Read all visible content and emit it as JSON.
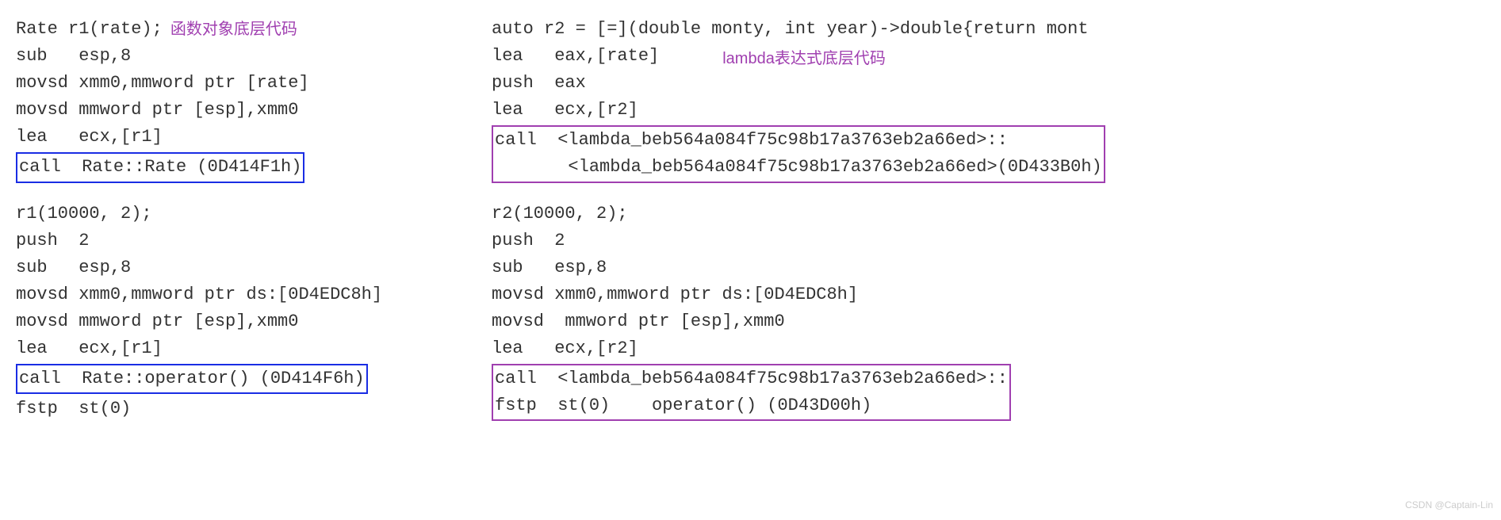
{
  "left": {
    "annotation": "函数对象底层代码",
    "decl": "Rate r1(rate);",
    "asm1": [
      "sub   esp,8",
      "movsd xmm0,mmword ptr [rate]",
      "movsd mmword ptr [esp],xmm0",
      "lea   ecx,[r1]"
    ],
    "box1": "call  Rate::Rate (0D414F1h)",
    "invoke": "r1(10000, 2);",
    "asm2": [
      "push  2",
      "sub   esp,8",
      "movsd xmm0,mmword ptr ds:[0D4EDC8h]",
      "movsd mmword ptr [esp],xmm0",
      "lea   ecx,[r1]"
    ],
    "box2": "call  Rate::operator() (0D414F6h)",
    "tail": "fstp  st(0)"
  },
  "right": {
    "annotation": "lambda表达式底层代码",
    "decl": "auto r2 = [=](double monty, int year)->double{return mont",
    "asm1": [
      "lea   eax,[rate]",
      "push  eax",
      "lea   ecx,[r2]"
    ],
    "box1a": "call  <lambda_beb564a084f75c98b17a3763eb2a66ed>::",
    "box1b": "       <lambda_beb564a084f75c98b17a3763eb2a66ed>(0D433B0h)",
    "invoke": "r2(10000, 2);",
    "asm2": [
      "push  2",
      "sub   esp,8",
      "movsd xmm0,mmword ptr ds:[0D4EDC8h]",
      "movsd  mmword ptr [esp],xmm0",
      "lea   ecx,[r2]"
    ],
    "box2a": "call  <lambda_beb564a084f75c98b17a3763eb2a66ed>::",
    "box2b": "fstp  st(0)    operator() (0D43D00h)"
  },
  "watermark": "CSDN @Captain-Lin"
}
